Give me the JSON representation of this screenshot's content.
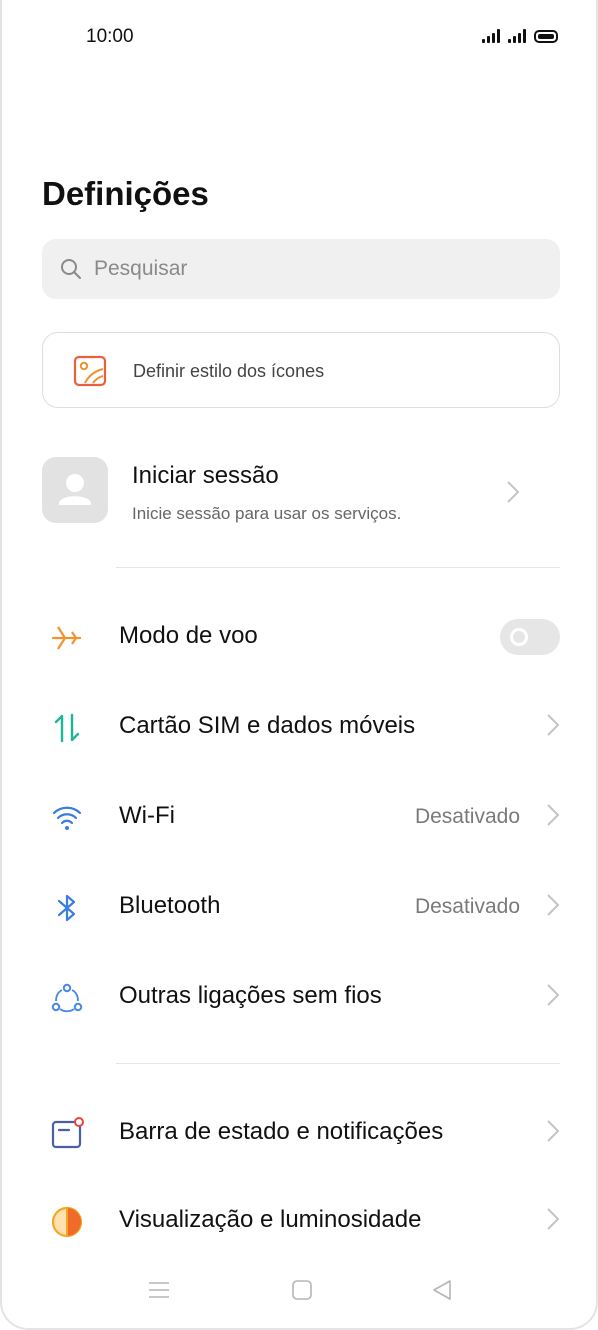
{
  "status_bar": {
    "time": "10:00"
  },
  "page_title": "Definições",
  "search": {
    "placeholder": "Pesquisar"
  },
  "style_card": {
    "label": "Definir estilo dos ícones"
  },
  "account": {
    "title": "Iniciar sessão",
    "subtitle": "Inicie sessão para usar os serviços."
  },
  "settings": [
    {
      "label": "Modo de voo",
      "icon": "airplane-icon",
      "control": "toggle",
      "toggle_on": false
    },
    {
      "label": "Cartão SIM e dados móveis",
      "icon": "sim-data-icon"
    },
    {
      "label": "Wi-Fi",
      "value": "Desativado",
      "icon": "wifi-icon"
    },
    {
      "label": "Bluetooth",
      "value": "Desativado",
      "icon": "bluetooth-icon"
    },
    {
      "label": "Outras ligações sem fios",
      "icon": "connections-icon"
    },
    {
      "label": "Barra de estado e notificações",
      "icon": "notification-bar-icon"
    },
    {
      "label": "Visualização e luminosidade",
      "icon": "display-brightness-icon"
    }
  ],
  "colors": {
    "airplane": "#f0922e",
    "sim": "#1fb59a",
    "wifi": "#3a7de0",
    "bluetooth": "#3a7de0",
    "connections": "#4a86e8",
    "notification": "#4a5fa8",
    "notification_dot": "#e8453c",
    "display": "#f5a623",
    "style_icon": "#e8603c"
  },
  "nav_bar": {
    "icons": [
      "menu-icon",
      "home-icon",
      "back-icon"
    ]
  }
}
